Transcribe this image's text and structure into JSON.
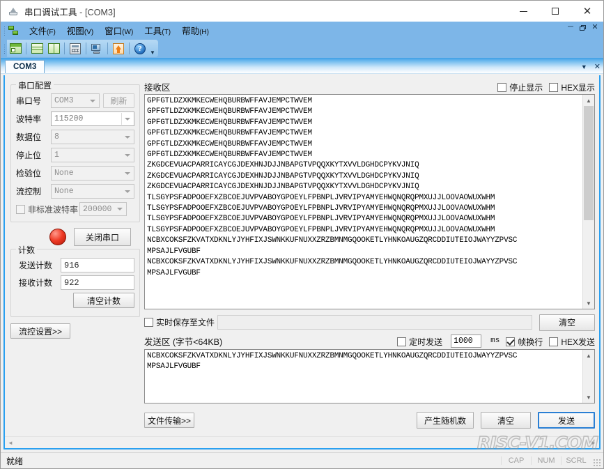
{
  "window": {
    "title_app": "串口调试工具",
    "title_doc": " - [COM3]",
    "minimize": "—",
    "maximize": "□",
    "close": "✕"
  },
  "menubar": {
    "items": [
      {
        "label": "文件",
        "mnemonic": "(F)"
      },
      {
        "label": "视图",
        "mnemonic": "(V)"
      },
      {
        "label": "窗口",
        "mnemonic": "(W)"
      },
      {
        "label": "工具",
        "mnemonic": "(T)"
      },
      {
        "label": "帮助",
        "mnemonic": "(H)"
      }
    ],
    "mdi_minimize": "－",
    "mdi_close": "✕"
  },
  "toolbar": {
    "icons": [
      "new-window-icon",
      "tile-horizontal-icon",
      "tile-vertical-icon",
      "calculator-icon",
      "monitor-icon",
      "upload-icon",
      "help-icon"
    ],
    "overflow": "▼"
  },
  "tabs": {
    "items": [
      {
        "label": "COM3",
        "active": true
      }
    ],
    "dropdown": "▼",
    "close": "✕"
  },
  "config": {
    "group_title": "串口配置",
    "port": {
      "label": "串口号",
      "value": "COM3"
    },
    "refresh_button": "刷新",
    "baud": {
      "label": "波特率",
      "value": "115200"
    },
    "databits": {
      "label": "数据位",
      "value": "8"
    },
    "stopbits": {
      "label": "停止位",
      "value": "1"
    },
    "parity": {
      "label": "检验位",
      "value": "None"
    },
    "flowcontrol": {
      "label": "流控制",
      "value": "None"
    },
    "custom_baud": {
      "label": "非标准波特率",
      "value": "200000",
      "checked": false
    }
  },
  "port_control": {
    "led": "red-led-indicator",
    "button": "关闭串口"
  },
  "counter": {
    "group_title": "计数",
    "tx_label": "发送计数",
    "tx_value": "916",
    "rx_label": "接收计数",
    "rx_value": "922",
    "clear_button": "清空计数"
  },
  "flow_settings_button": "流控设置>>",
  "receive": {
    "title": "接收区",
    "stop_display": {
      "label": "停止显示",
      "checked": false
    },
    "hex_display": {
      "label": "HEX显示",
      "checked": false
    },
    "text": "GPFGTLDZXKMKECWEHQBURBWFFAVJEMPCTWVEM\nGPFGTLDZXKMKECWEHQBURBWFFAVJEMPCTWVEM\nGPFGTLDZXKMKECWEHQBURBWFFAVJEMPCTWVEM\nGPFGTLDZXKMKECWEHQBURBWFFAVJEMPCTWVEM\nGPFGTLDZXKMKECWEHQBURBWFFAVJEMPCTWVEM\nGPFGTLDZXKMKECWEHQBURBWFFAVJEMPCTWVEM\nZKGDCEVUACPARRICAYCGJDEXHNJDJJNBAPGTVPQQXKYTXVVLDGHDCPYKVJNIQ\nZKGDCEVUACPARRICAYCGJDEXHNJDJJNBAPGTVPQQXKYTXVVLDGHDCPYKVJNIQ\nZKGDCEVUACPARRICAYCGJDEXHNJDJJNBAPGTVPQQXKYTXVVLDGHDCPYKVJNIQ\nTLSGYPSFADPOOEFXZBCOEJUVPVABOYGPOEYLFPBNPLJVRVIPYAMYEHWQNQRQPMXUJJLOOVAOWUXWHM\nTLSGYPSFADPOOEFXZBCOEJUVPVABOYGPOEYLFPBNPLJVRVIPYAMYEHWQNQRQPMXUJJLOOVAOWUXWHM\nTLSGYPSFADPOOEFXZBCOEJUVPVABOYGPOEYLFPBNPLJVRVIPYAMYEHWQNQRQPMXUJJLOOVAOWUXWHM\nTLSGYPSFADPOOEFXZBCOEJUVPVABOYGPOEYLFPBNPLJVRVIPYAMYEHWQNQRQPMXUJJLOOVAOWUXWHM\nNCBXCOKSFZKVATXDKNLYJYHFIXJSWNKKUFNUXXZRZBMNMGQOOKETLYHNKOAUGZQRCDDIUTEIOJWAYYZPVSC\nMPSAJLFVGUBF\nNCBXCOKSFZKVATXDKNLYJYHFIXJSWNKKUFNUXXZRZBMNMGQOOKETLYHNKOAUGZQRCDDIUTEIOJWAYYZPVSC\nMPSAJLFVGUBF",
    "scroll_up": "▲",
    "scroll_down": "▼"
  },
  "save_to_file": {
    "label": "实时保存至文件",
    "checked": false,
    "path": "",
    "clear_button": "清空"
  },
  "send": {
    "title": "发送区 (字节<64KB)",
    "timed_send": {
      "label": "定时发送",
      "checked": false
    },
    "interval_value": "1000",
    "interval_unit": "ms",
    "frame_newline": {
      "label": "帧换行",
      "checked": true
    },
    "hex_send": {
      "label": "HEX发送",
      "checked": false
    },
    "text": "NCBXCOKSFZKVATXDKNLYJYHFIXJSWNKKUFNUXXZRZBMNMGQOOKETLYHNKOAUGZQRCDDIUTEIOJWAYYZPVSC\nMPSAJLFVGUBF",
    "scroll_up": "▲",
    "scroll_down": "▼"
  },
  "bottom_buttons": {
    "file_transfer": "文件传输>>",
    "random": "产生随机数",
    "clear": "清空",
    "send": "发送"
  },
  "child_scroll": {
    "left": "◄",
    "right": "►"
  },
  "statusbar": {
    "text": "就绪",
    "cap": "CAP",
    "num": "NUM",
    "scrl": "SCRL"
  },
  "watermark": "RISC-V1.COM"
}
